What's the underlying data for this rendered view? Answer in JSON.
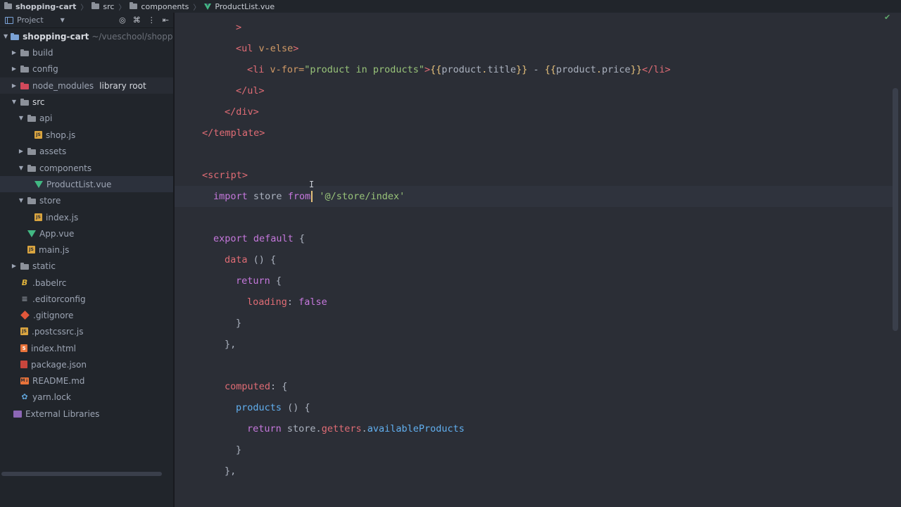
{
  "breadcrumb": [
    "shopping-cart",
    "src",
    "components",
    "ProductList.vue"
  ],
  "project_header": {
    "label": "Project"
  },
  "tree": [
    {
      "label": "shopping-cart",
      "note": "~/vueschool/shopping-c",
      "indent": 0,
      "arrow": "down",
      "icon": "project-folder",
      "style": "bold"
    },
    {
      "label": "build",
      "indent": 1,
      "arrow": "right",
      "icon": "folder"
    },
    {
      "label": "config",
      "indent": 1,
      "arrow": "right",
      "icon": "folder"
    },
    {
      "label": "node_modules",
      "note": "library root",
      "indent": 1,
      "arrow": "right",
      "icon": "folder-red",
      "row": "highlight"
    },
    {
      "label": "src",
      "indent": 1,
      "arrow": "down",
      "icon": "folder",
      "style": "light"
    },
    {
      "label": "api",
      "indent": 2,
      "arrow": "down",
      "icon": "folder"
    },
    {
      "label": "shop.js",
      "indent": 3,
      "arrow": "none",
      "icon": "js"
    },
    {
      "label": "assets",
      "indent": 2,
      "arrow": "right",
      "icon": "folder"
    },
    {
      "label": "components",
      "indent": 2,
      "arrow": "down",
      "icon": "folder"
    },
    {
      "label": "ProductList.vue",
      "indent": 3,
      "arrow": "none",
      "icon": "vue",
      "row": "selected"
    },
    {
      "label": "store",
      "indent": 2,
      "arrow": "down",
      "icon": "folder"
    },
    {
      "label": "index.js",
      "indent": 3,
      "arrow": "none",
      "icon": "js"
    },
    {
      "label": "App.vue",
      "indent": 2,
      "arrow": "none",
      "icon": "vue"
    },
    {
      "label": "main.js",
      "indent": 2,
      "arrow": "none",
      "icon": "js"
    },
    {
      "label": "static",
      "indent": 1,
      "arrow": "right",
      "icon": "folder"
    },
    {
      "label": ".babelrc",
      "indent": 1,
      "arrow": "none",
      "icon": "babel"
    },
    {
      "label": ".editorconfig",
      "indent": 1,
      "arrow": "none",
      "icon": "config"
    },
    {
      "label": ".gitignore",
      "indent": 1,
      "arrow": "none",
      "icon": "git"
    },
    {
      "label": ".postcssrc.js",
      "indent": 1,
      "arrow": "none",
      "icon": "js"
    },
    {
      "label": "index.html",
      "indent": 1,
      "arrow": "none",
      "icon": "html"
    },
    {
      "label": "package.json",
      "indent": 1,
      "arrow": "none",
      "icon": "json"
    },
    {
      "label": "README.md",
      "indent": 1,
      "arrow": "none",
      "icon": "md"
    },
    {
      "label": "yarn.lock",
      "indent": 1,
      "arrow": "none",
      "icon": "yarn"
    },
    {
      "label": "External Libraries",
      "indent": 0,
      "arrow": "none",
      "icon": "library"
    }
  ],
  "code": [
    {
      "indent": 3,
      "tokens": [
        [
          "tag",
          ">"
        ]
      ]
    },
    {
      "indent": 3,
      "tokens": [
        [
          "tag",
          "<ul "
        ],
        [
          "attr",
          "v-else"
        ],
        [
          "tag",
          ">"
        ]
      ]
    },
    {
      "indent": 4,
      "tokens": [
        [
          "tag",
          "<li "
        ],
        [
          "attr",
          "v-for="
        ],
        [
          "str",
          "\"product in products\""
        ],
        [
          "tag",
          ">"
        ],
        [
          "mus",
          "{{"
        ],
        [
          "plain",
          "product"
        ],
        [
          "mus",
          "."
        ],
        [
          "plain",
          "title"
        ],
        [
          "mus",
          "}}"
        ],
        [
          "plain",
          " - "
        ],
        [
          "mus",
          "{{"
        ],
        [
          "plain",
          "product"
        ],
        [
          "mus",
          "."
        ],
        [
          "plain",
          "price"
        ],
        [
          "mus",
          "}}"
        ],
        [
          "tag",
          "</li>"
        ]
      ]
    },
    {
      "indent": 3,
      "tokens": [
        [
          "tag",
          "</ul>"
        ]
      ]
    },
    {
      "indent": 2,
      "tokens": [
        [
          "tag",
          "</div>"
        ]
      ]
    },
    {
      "indent": 0,
      "tokens": [
        [
          "tag",
          "</template>"
        ]
      ]
    },
    {
      "indent": 0,
      "tokens": []
    },
    {
      "indent": 0,
      "tokens": [
        [
          "tag",
          "<script>"
        ]
      ]
    },
    {
      "indent": 1,
      "current": true,
      "tokens": [
        [
          "kw",
          "import"
        ],
        [
          "plain",
          " store "
        ],
        [
          "kw",
          "from"
        ],
        [
          "caret",
          ""
        ],
        [
          "plain",
          " "
        ],
        [
          "str",
          "'@/store/index'"
        ]
      ]
    },
    {
      "indent": 0,
      "tokens": []
    },
    {
      "indent": 1,
      "tokens": [
        [
          "kw",
          "export default"
        ],
        [
          "plain",
          " {"
        ]
      ]
    },
    {
      "indent": 2,
      "tokens": [
        [
          "prop",
          "data"
        ],
        [
          "plain",
          " () {"
        ]
      ]
    },
    {
      "indent": 3,
      "tokens": [
        [
          "kw",
          "return"
        ],
        [
          "plain",
          " {"
        ]
      ]
    },
    {
      "indent": 4,
      "tokens": [
        [
          "prop",
          "loading"
        ],
        [
          "plain",
          ": "
        ],
        [
          "kw",
          "false"
        ]
      ]
    },
    {
      "indent": 3,
      "tokens": [
        [
          "plain",
          "}"
        ]
      ]
    },
    {
      "indent": 2,
      "tokens": [
        [
          "plain",
          "},"
        ]
      ]
    },
    {
      "indent": 0,
      "tokens": []
    },
    {
      "indent": 2,
      "tokens": [
        [
          "prop",
          "computed"
        ],
        [
          "plain",
          ": {"
        ]
      ]
    },
    {
      "indent": 3,
      "tokens": [
        [
          "fn",
          "products"
        ],
        [
          "plain",
          " () {"
        ]
      ]
    },
    {
      "indent": 4,
      "tokens": [
        [
          "kw",
          "return"
        ],
        [
          "plain",
          " store."
        ],
        [
          "prop",
          "getters"
        ],
        [
          "plain",
          "."
        ],
        [
          "fn",
          "availableProducts"
        ]
      ]
    },
    {
      "indent": 3,
      "tokens": [
        [
          "plain",
          "}"
        ]
      ]
    },
    {
      "indent": 2,
      "tokens": [
        [
          "plain",
          "},"
        ]
      ]
    }
  ]
}
